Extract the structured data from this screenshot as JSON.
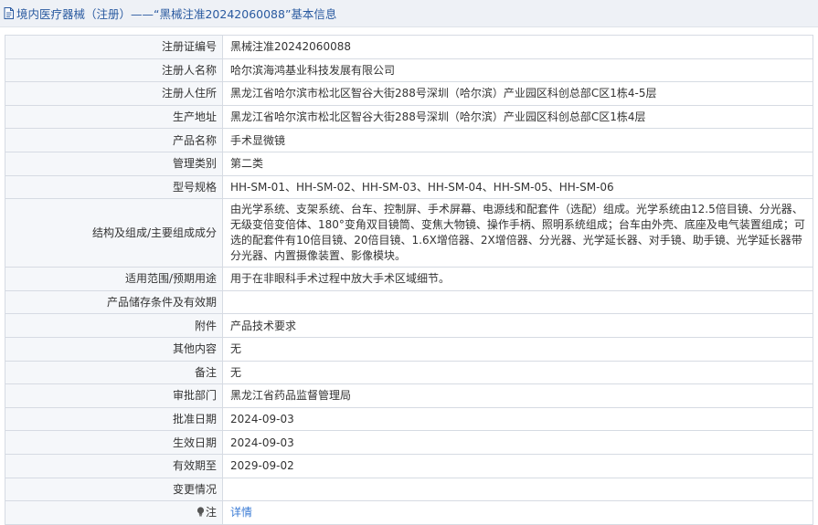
{
  "header": {
    "title": "境内医疗器械（注册）——“黑械注准20242060088”基本信息",
    "icon": "document-icon"
  },
  "rows": [
    {
      "label": "注册证编号",
      "value": "黑械注准20242060088"
    },
    {
      "label": "注册人名称",
      "value": "哈尔滨海鸿基业科技发展有限公司"
    },
    {
      "label": "注册人住所",
      "value": "黑龙江省哈尔滨市松北区智谷大街288号深圳（哈尔滨）产业园区科创总部C区1栋4-5层"
    },
    {
      "label": "生产地址",
      "value": "黑龙江省哈尔滨市松北区智谷大街288号深圳（哈尔滨）产业园区科创总部C区1栋4层"
    },
    {
      "label": "产品名称",
      "value": "手术显微镜"
    },
    {
      "label": "管理类别",
      "value": "第二类"
    },
    {
      "label": "型号规格",
      "value": "HH-SM-01、HH-SM-02、HH-SM-03、HH-SM-04、HH-SM-05、HH-SM-06"
    },
    {
      "label": "结构及组成/主要组成成分",
      "value": "由光学系统、支架系统、台车、控制屏、手术屏幕、电源线和配套件（选配）组成。光学系统由12.5倍目镜、分光器、无级变倍变倍体、180°变角双目镜筒、变焦大物镜、操作手柄、照明系统组成；台车由外壳、底座及电气装置组成；可选的配套件有10倍目镜、20倍目镜、1.6X增倍器、2X增倍器、分光器、光学延长器、对手镜、助手镜、光学延长器带分光器、内置摄像装置、影像模块。"
    },
    {
      "label": "适用范围/预期用途",
      "value": "用于在非眼科手术过程中放大手术区域细节。"
    },
    {
      "label": "产品储存条件及有效期",
      "value": ""
    },
    {
      "label": "附件",
      "value": "产品技术要求"
    },
    {
      "label": "其他内容",
      "value": "无"
    },
    {
      "label": "备注",
      "value": "无"
    },
    {
      "label": "审批部门",
      "value": "黑龙江省药品监督管理局"
    },
    {
      "label": "批准日期",
      "value": "2024-09-03"
    },
    {
      "label": "生效日期",
      "value": "2024-09-03"
    },
    {
      "label": "有效期至",
      "value": "2029-09-02"
    },
    {
      "label": "变更情况",
      "value": ""
    }
  ],
  "note": {
    "label": "注",
    "icon": "lightbulb-icon",
    "link_text": "详情",
    "link_color": "#3a7bd5"
  },
  "colors": {
    "title_text": "#2a5aa0",
    "header_bg": "#eef1f6",
    "label_bg": "#f5f7fa",
    "border": "#d6dbe3"
  }
}
